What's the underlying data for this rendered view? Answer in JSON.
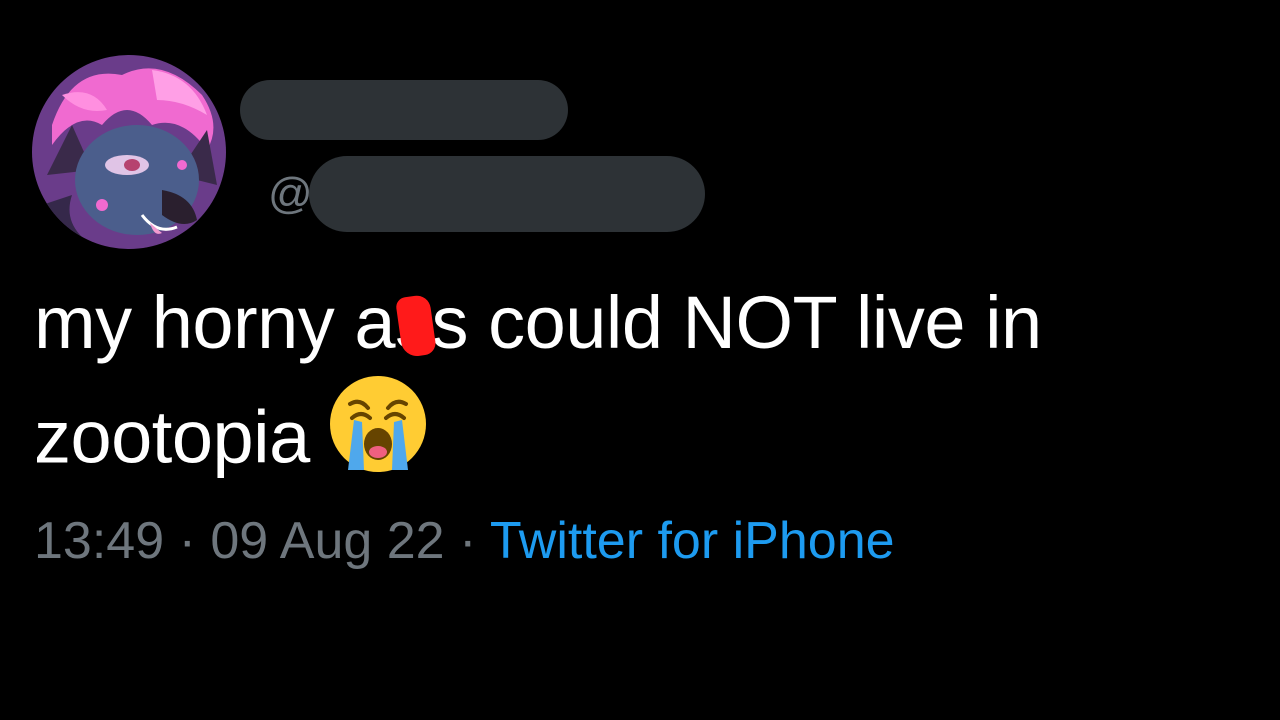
{
  "tweet": {
    "handle_prefix": "@",
    "text_part1": "my horny a",
    "text_censored": "s",
    "text_part2": "s could NOT live in",
    "text_line2": "zootopia",
    "emoji_icon": "loudly-crying-face-icon",
    "time": "13:49",
    "separator": "·",
    "date": "09 Aug 22",
    "source": "Twitter for iPhone"
  },
  "colors": {
    "background": "#000000",
    "text": "#ffffff",
    "muted": "#6e767d",
    "link": "#1d9bf0",
    "redaction": "#2d3236",
    "censor": "#ff1a1a"
  }
}
